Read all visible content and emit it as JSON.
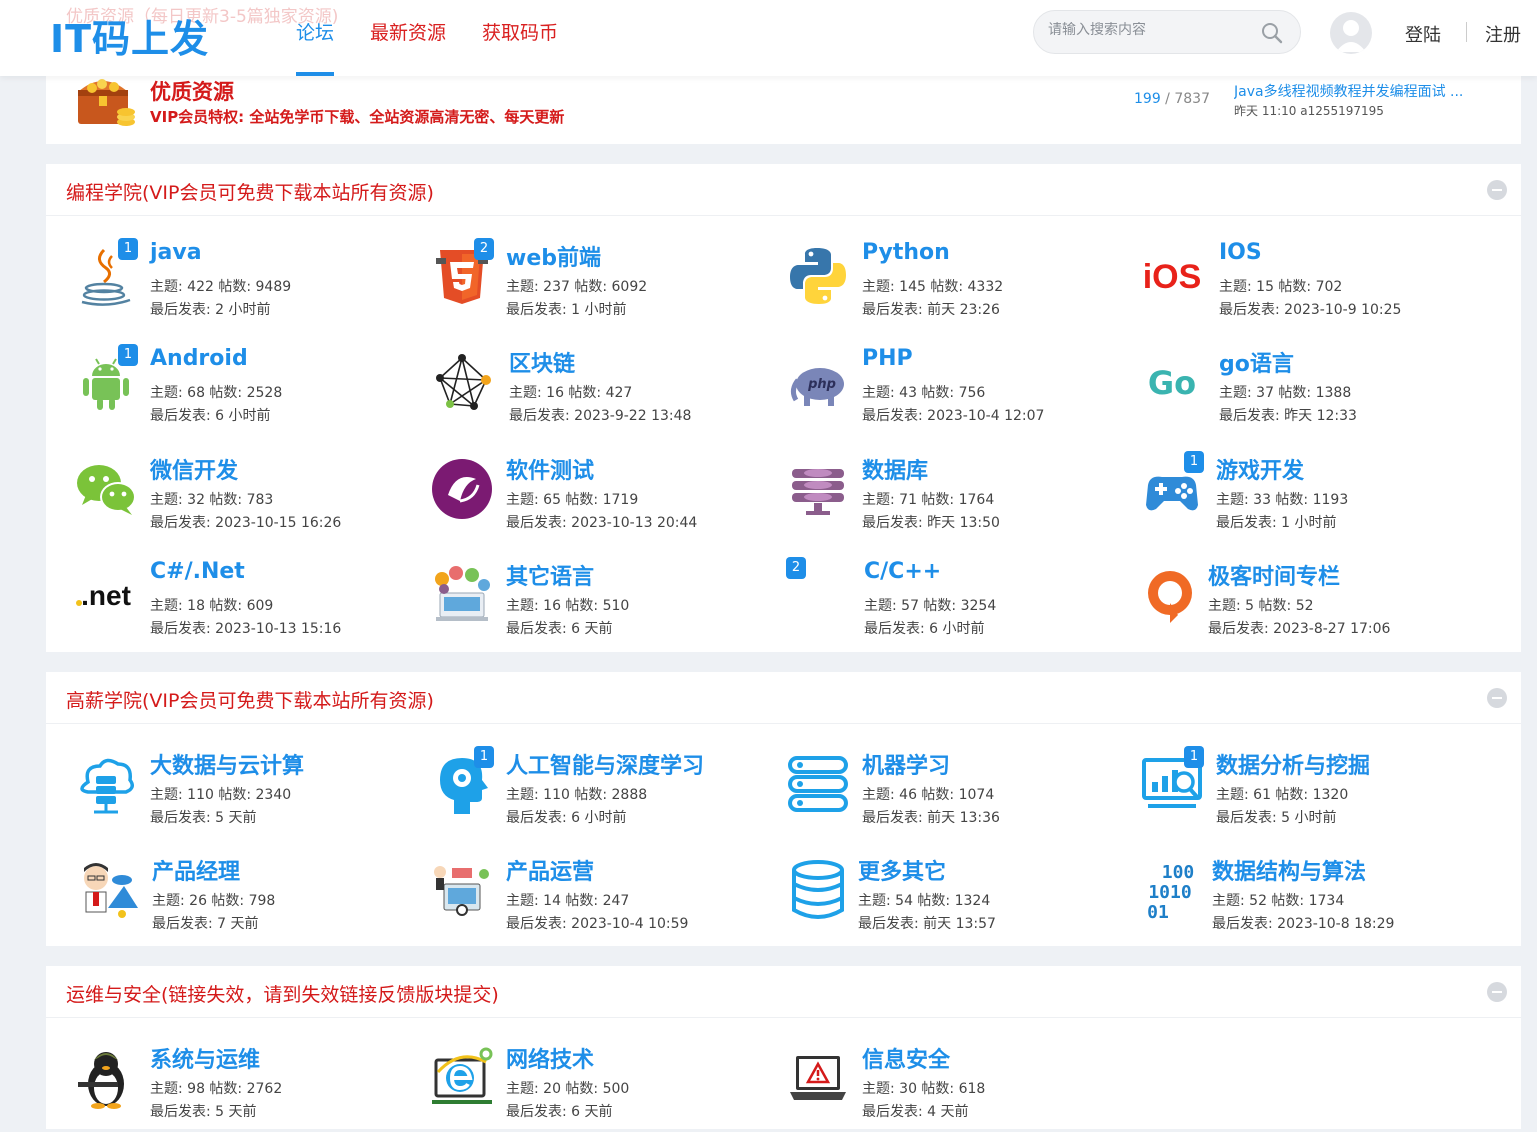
{
  "header": {
    "faded_text": "优质资源（每日更新3-5篇独家资源)",
    "logo": "IT码上发",
    "nav": [
      "论坛",
      "最新资源",
      "获取码币"
    ],
    "search_placeholder": "请输入搜索内容",
    "login": "登陆",
    "register": "注册"
  },
  "promo": {
    "title": "优质资源",
    "subtitle": "VIP会员特权: 全站免学币下载、全站资源高清无密、每天更新",
    "count_a": "199",
    "count_sep": " / ",
    "count_b": "7837",
    "latest_title": "Java多线程视频教程并发编程面试 ...",
    "latest_meta": "昨天 11:10 a1255197195"
  },
  "sections": [
    {
      "title": "编程学院(VIP会员可免费下载本站所有资源)",
      "forums": [
        {
          "name": "java",
          "icon": "java-icon",
          "badge": "1",
          "stats": "主题: 422 帖数: 9489",
          "last": "最后发表: 2 小时前"
        },
        {
          "name": "web前端",
          "icon": "html5-icon",
          "badge": "2",
          "stats": "主题: 237 帖数: 6092",
          "last": "最后发表: 1 小时前"
        },
        {
          "name": "Python",
          "icon": "python-icon",
          "badge": "",
          "stats": "主题: 145 帖数: 4332",
          "last": "最后发表: 前天 23:26"
        },
        {
          "name": "IOS",
          "icon": "ios-icon",
          "badge": "",
          "stats": "主题: 15 帖数: 702",
          "last": "最后发表: 2023-10-9 10:25"
        },
        {
          "name": "Android",
          "icon": "android-icon",
          "badge": "1",
          "stats": "主题: 68 帖数: 2528",
          "last": "最后发表: 6 小时前"
        },
        {
          "name": "区块链",
          "icon": "blockchain-icon",
          "badge": "",
          "stats": "主题: 16 帖数: 427",
          "last": "最后发表: 2023-9-22 13:48"
        },
        {
          "name": "PHP",
          "icon": "php-icon",
          "badge": "",
          "stats": "主题: 43 帖数: 756",
          "last": "最后发表: 2023-10-4 12:07"
        },
        {
          "name": "go语言",
          "icon": "go-icon",
          "badge": "",
          "stats": "主题: 37 帖数: 1388",
          "last": "最后发表: 昨天 12:33"
        },
        {
          "name": "微信开发",
          "icon": "wechat-icon",
          "badge": "",
          "stats": "主题: 32 帖数: 783",
          "last": "最后发表: 2023-10-15 16:26"
        },
        {
          "name": "软件测试",
          "icon": "testing-icon",
          "badge": "",
          "stats": "主题: 65 帖数: 1719",
          "last": "最后发表: 2023-10-13 20:44"
        },
        {
          "name": "数据库",
          "icon": "database-icon",
          "badge": "",
          "stats": "主题: 71 帖数: 1764",
          "last": "最后发表: 昨天 13:50"
        },
        {
          "name": "游戏开发",
          "icon": "gamepad-icon",
          "badge": "1",
          "stats": "主题: 33 帖数: 1193",
          "last": "最后发表: 1 小时前"
        },
        {
          "name": "C#/.Net",
          "icon": "dotnet-icon",
          "badge": "",
          "stats": "主题: 18 帖数: 609",
          "last": "最后发表: 2023-10-13 15:16"
        },
        {
          "name": "其它语言",
          "icon": "languages-icon",
          "badge": "",
          "stats": "主题: 16 帖数: 510",
          "last": "最后发表: 6 天前"
        },
        {
          "name": "C/C++",
          "icon": "cpp-icon",
          "badge": "2",
          "stats": "主题: 57 帖数: 3254",
          "last": "最后发表: 6 小时前"
        },
        {
          "name": "极客时间专栏",
          "icon": "geektime-icon",
          "badge": "",
          "stats": "主题: 5 帖数: 52",
          "last": "最后发表: 2023-8-27 17:06"
        }
      ]
    },
    {
      "title": "高薪学院(VIP会员可免费下载本站所有资源)",
      "forums": [
        {
          "name": "大数据与云计算",
          "icon": "cloud-server-icon",
          "badge": "",
          "stats": "主题: 110 帖数: 2340",
          "last": "最后发表: 5 天前"
        },
        {
          "name": "人工智能与深度学习",
          "icon": "ai-head-icon",
          "badge": "1",
          "stats": "主题: 110 帖数: 2888",
          "last": "最后发表: 6 小时前"
        },
        {
          "name": "机器学习",
          "icon": "server-stack-icon",
          "badge": "",
          "stats": "主题: 46 帖数: 1074",
          "last": "最后发表: 前天 13:36"
        },
        {
          "name": "数据分析与挖掘",
          "icon": "analytics-icon",
          "badge": "1",
          "stats": "主题: 61 帖数: 1320",
          "last": "最后发表: 5 小时前"
        },
        {
          "name": "产品经理",
          "icon": "product-manager-icon",
          "badge": "",
          "stats": "主题: 26 帖数: 798",
          "last": "最后发表: 7 天前"
        },
        {
          "name": "产品运营",
          "icon": "operations-icon",
          "badge": "",
          "stats": "主题: 14 帖数: 247",
          "last": "最后发表: 2023-10-4 10:59"
        },
        {
          "name": "更多其它",
          "icon": "db-cylinder-icon",
          "badge": "",
          "stats": "主题: 54 帖数: 1324",
          "last": "最后发表: 前天 13:57"
        },
        {
          "name": "数据结构与算法",
          "icon": "binary-icon",
          "badge": "",
          "stats": "主题: 52 帖数: 1734",
          "last": "最后发表: 2023-10-8 18:29"
        }
      ]
    },
    {
      "title": "运维与安全(链接失效，请到失效链接反馈版块提交)",
      "forums": [
        {
          "name": "系统与运维",
          "icon": "linux-penguin-icon",
          "badge": "",
          "stats": "主题: 98 帖数: 2762",
          "last": "最后发表: 5 天前"
        },
        {
          "name": "网络技术",
          "icon": "ie-network-icon",
          "badge": "",
          "stats": "主题: 20 帖数: 500",
          "last": "最后发表: 6 天前"
        },
        {
          "name": "信息安全",
          "icon": "laptop-alert-icon",
          "badge": "",
          "stats": "主题: 30 帖数: 618",
          "last": "最后发表: 4 天前"
        }
      ]
    }
  ],
  "binary_glyph": "100\n1010\n01",
  "ios_glyph": "iOS",
  "net_glyph": ".net",
  "go_glyph": "Go",
  "php_glyph": "php"
}
